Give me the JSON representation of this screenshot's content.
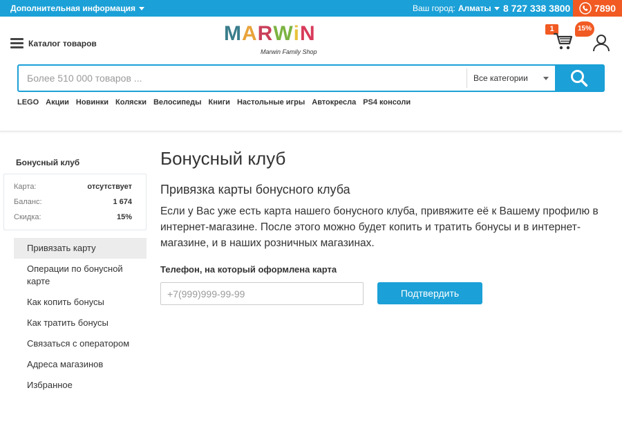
{
  "topbar": {
    "info_label": "Дополнительная информация",
    "city_label": "Ваш город:",
    "city_value": "Алматы",
    "phone": "8 727 338 3800",
    "callback_number": "7890"
  },
  "header": {
    "catalog_label": "Каталог товаров",
    "logo": {
      "text": "MARWIN",
      "subtitle": "Marwin Family Shop"
    },
    "cart_count": "1",
    "discount_badge": "15%",
    "search": {
      "placeholder": "Более 510 000 товаров ...",
      "category": "Все категории"
    },
    "quicklinks": [
      "LEGO",
      "Акции",
      "Новинки",
      "Коляски",
      "Велосипеды",
      "Книги",
      "Настольные игры",
      "Автокресла",
      "PS4 консоли"
    ]
  },
  "sidebar": {
    "title": "Бонусный клуб",
    "card": {
      "card_label": "Карта:",
      "card_value": "отсутствует",
      "balance_label": "Баланс:",
      "balance_value": "1 674",
      "discount_label": "Скидка:",
      "discount_value": "15%"
    },
    "menu": [
      "Привязать карту",
      "Операции по бонусной карте",
      "Как копить бонусы",
      "Как тратить бонусы",
      "Связаться с оператором",
      "Адреса магазинов",
      "Избранное"
    ]
  },
  "main": {
    "title": "Бонусный клуб",
    "subtitle": "Привязка карты бонусного клуба",
    "text": "Если у Вас уже есть карта нашего бонусного клуба, привяжите её к Вашему профилю в интернет-магазине. После этого можно будет копить и тратить бонусы и в интернет-магазине, и в наших розничных магазинах.",
    "phone_label": "Телефон, на который оформлена карта",
    "phone_placeholder": "+7(999)999-99-99",
    "confirm_label": "Подтвердить"
  },
  "colors": {
    "primary": "#1ba0d7",
    "accent": "#f15a22"
  },
  "icons": [
    "chevron-down-icon",
    "phone-icon",
    "menu-icon",
    "cart-icon",
    "user-icon",
    "search-icon"
  ]
}
